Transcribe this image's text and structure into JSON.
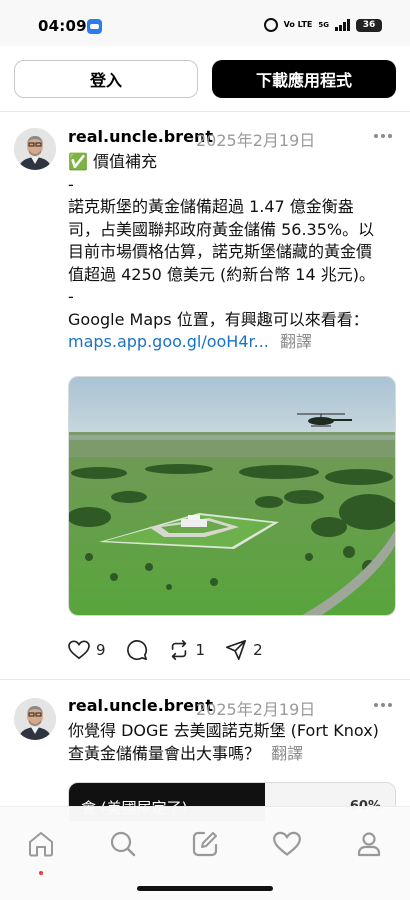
{
  "status_bar": {
    "time": "04:09",
    "volte": "Vo\nLTE",
    "network": "5G",
    "battery": "36"
  },
  "top_bar": {
    "login_label": "登入",
    "download_label": "下載應用程式"
  },
  "posts": [
    {
      "username": "real.uncle.brent",
      "date": "2025年2月19日",
      "lines": [
        "✅ 價值補充",
        "-",
        "諾克斯堡的黃金儲備超過 1.47 億金衡盎",
        "司，占美國聯邦政府黃金儲備 56.35%。以",
        "目前市場價格估算，諾克斯堡儲藏的黃金價",
        "值超過 4250 億美元 (約新台幣 14 兆元)。",
        "-",
        "Google Maps 位置，有興趣可以來看看："
      ],
      "link": "maps.app.goo.gl/ooH4r...",
      "translate": "翻譯",
      "actions": {
        "likes": "9",
        "replies": "",
        "reposts": "1",
        "shares": "2"
      }
    },
    {
      "username": "real.uncle.brent",
      "date": "2025年2月19日",
      "lines": [
        "你覺得 DOGE 去美國諾克斯堡 (Fort Knox)",
        "查黃金儲備量會出大事嗎？"
      ],
      "translate": "翻譯",
      "poll": {
        "option": "會 (美國尿定了)",
        "percent": "60%",
        "fill_fraction": 0.6
      }
    }
  ],
  "colors": {
    "link": "#1a73c8",
    "muted": "#9a9a9a",
    "notification_dot": "#ff3040"
  },
  "nav": [
    "home-icon",
    "search-icon",
    "compose-icon",
    "heart-icon",
    "profile-icon"
  ]
}
